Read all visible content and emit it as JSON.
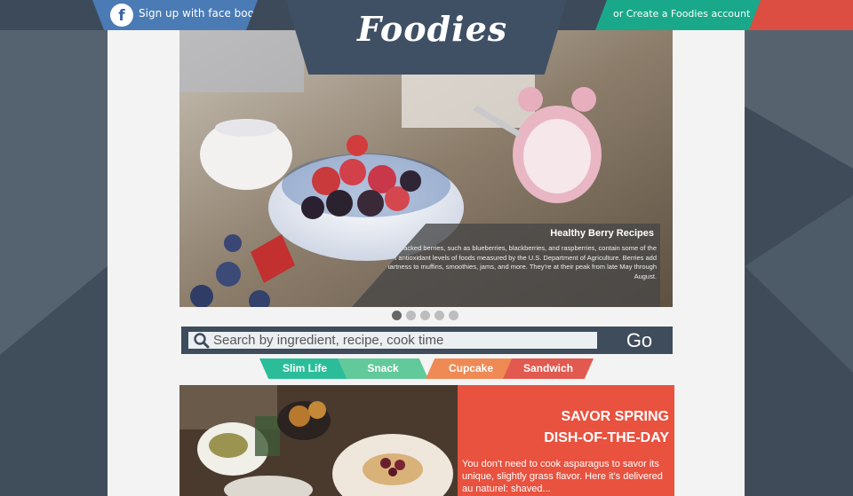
{
  "header": {
    "facebook_signup": "Sign up with face book",
    "facebook_icon": "facebook-icon",
    "create_account": "or Create a Foodies account",
    "logo": "Foodies"
  },
  "hero": {
    "title": "Healthy Berry Recipes",
    "description": "Antioxidant-packed berries, such as blueberries, blackberries, and raspberries, contain some of the highest antioxidant levels of foods measured by the U.S. Department of Agriculture. Berries add sweet tartness to muffins, smoothies, jams, and more. They're at their peak from late May through August.",
    "slides_total": 5,
    "active_slide": 1
  },
  "search": {
    "placeholder": "Search by ingredient, recipe, cook time",
    "go_label": "Go",
    "icon": "search-icon"
  },
  "tags": [
    {
      "label": "Slim Life",
      "color": "#2bbd9a"
    },
    {
      "label": "Snack",
      "color": "#62c99a"
    },
    {
      "label": "Cupcake",
      "color": "#ef8a55"
    },
    {
      "label": "Sandwich",
      "color": "#e2594f"
    }
  ],
  "dish": {
    "title_line1": "SAVOR SPRING",
    "title_line2": "DISH-OF-THE-DAY",
    "body": "You don't need to cook asparagus to savor its unique, slightly grass flavor. Here it's delivered au naturel: shaved..."
  },
  "colors": {
    "background": "#4a5868",
    "topbar": "#3d4a5a",
    "facebook": "#4a7bb5",
    "create_account": "#1aa88a",
    "accent_red": "#dc4e41",
    "dish_panel": "#e8523f"
  }
}
